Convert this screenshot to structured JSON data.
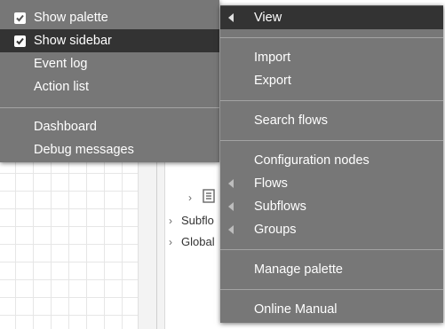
{
  "sidebar_tree": {
    "items": [
      {
        "label": "Subflo"
      },
      {
        "label": "Global"
      }
    ]
  },
  "left_menu": {
    "items": [
      {
        "label": "Show palette",
        "checked": true,
        "selected": false
      },
      {
        "label": "Show sidebar",
        "checked": true,
        "selected": true
      },
      {
        "label": "Event log",
        "checked": false,
        "selected": false
      },
      {
        "label": "Action list",
        "checked": false,
        "selected": false
      },
      {
        "label": "Dashboard",
        "checked": false,
        "selected": false
      },
      {
        "label": "Debug messages",
        "checked": false,
        "selected": false
      }
    ]
  },
  "right_menu": {
    "items": [
      {
        "label": "View",
        "submenu": true,
        "selected": true
      },
      {
        "label": "Import",
        "submenu": false
      },
      {
        "label": "Export",
        "submenu": false
      },
      {
        "label": "Search flows",
        "submenu": false
      },
      {
        "label": "Configuration nodes",
        "submenu": false
      },
      {
        "label": "Flows",
        "submenu": true
      },
      {
        "label": "Subflows",
        "submenu": true
      },
      {
        "label": "Groups",
        "submenu": true
      },
      {
        "label": "Manage palette",
        "submenu": false
      },
      {
        "label": "Online Manual",
        "submenu": false
      }
    ]
  },
  "colors": {
    "menu_bg": "#777777",
    "menu_selected": "#333333",
    "menu_text": "#ffffff"
  },
  "icons": [
    "check-icon",
    "submenu-arrow-icon",
    "chevron-right-icon",
    "flow-node-icon"
  ]
}
